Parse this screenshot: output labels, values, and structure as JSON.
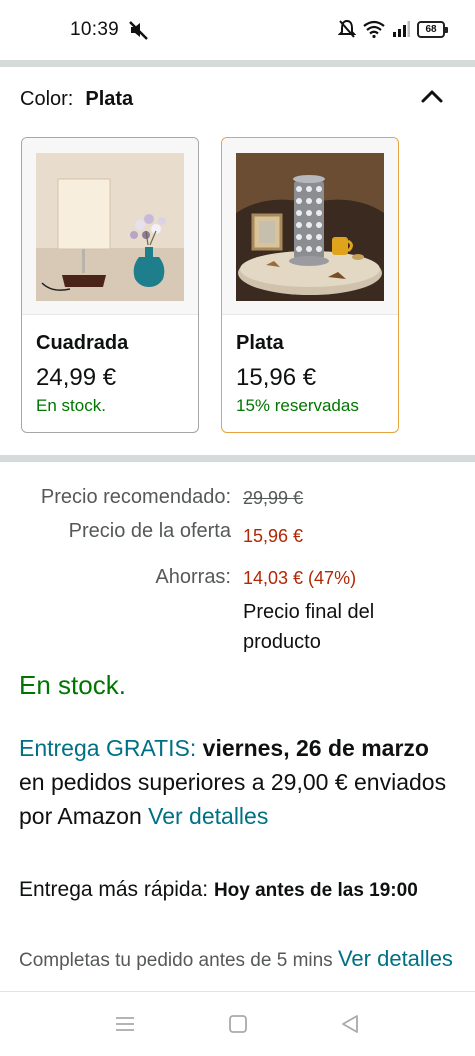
{
  "status_bar": {
    "time": "10:39",
    "battery": "68",
    "icons": [
      "mute-icon",
      "silent-bell-icon",
      "wifi-icon",
      "signal-icon",
      "battery-icon"
    ]
  },
  "color_selector": {
    "label": "Color:",
    "selected_value": "Plata",
    "collapse_icon": "chevron-up-icon"
  },
  "variants": [
    {
      "name": "Cuadrada",
      "price": "24,99 €",
      "availability": "En stock.",
      "selected": false
    },
    {
      "name": "Plata",
      "price": "15,96 €",
      "availability": "15% reservadas",
      "selected": true
    }
  ],
  "pricing": {
    "recommended_label": "Precio recomendado:",
    "recommended_value": "29,99 €",
    "deal_label": "Precio de la oferta",
    "deal_value": "15,96 €",
    "savings_label": "Ahorras:",
    "savings_value": "14,03 € (47%)",
    "final_note": "Precio final del producto"
  },
  "stock_status": "En stock.",
  "delivery": {
    "free_label": "Entrega GRATIS:",
    "date": "viernes, 26 de marzo",
    "condition": " en pedidos superiores a 29,00 € enviados por Amazon ",
    "details_link": "Ver detalles"
  },
  "fast_delivery": {
    "label": "Entrega más rápida: ",
    "when": "Hoy antes de las 19:00"
  },
  "order_within": {
    "text": "Completas tu pedido antes de 5 mins ",
    "details_link": "Ver detalles"
  },
  "colors": {
    "in_stock_green": "#007600",
    "price_red": "#b12704",
    "link_teal": "#007185",
    "selected_border": "#e7a33d"
  }
}
